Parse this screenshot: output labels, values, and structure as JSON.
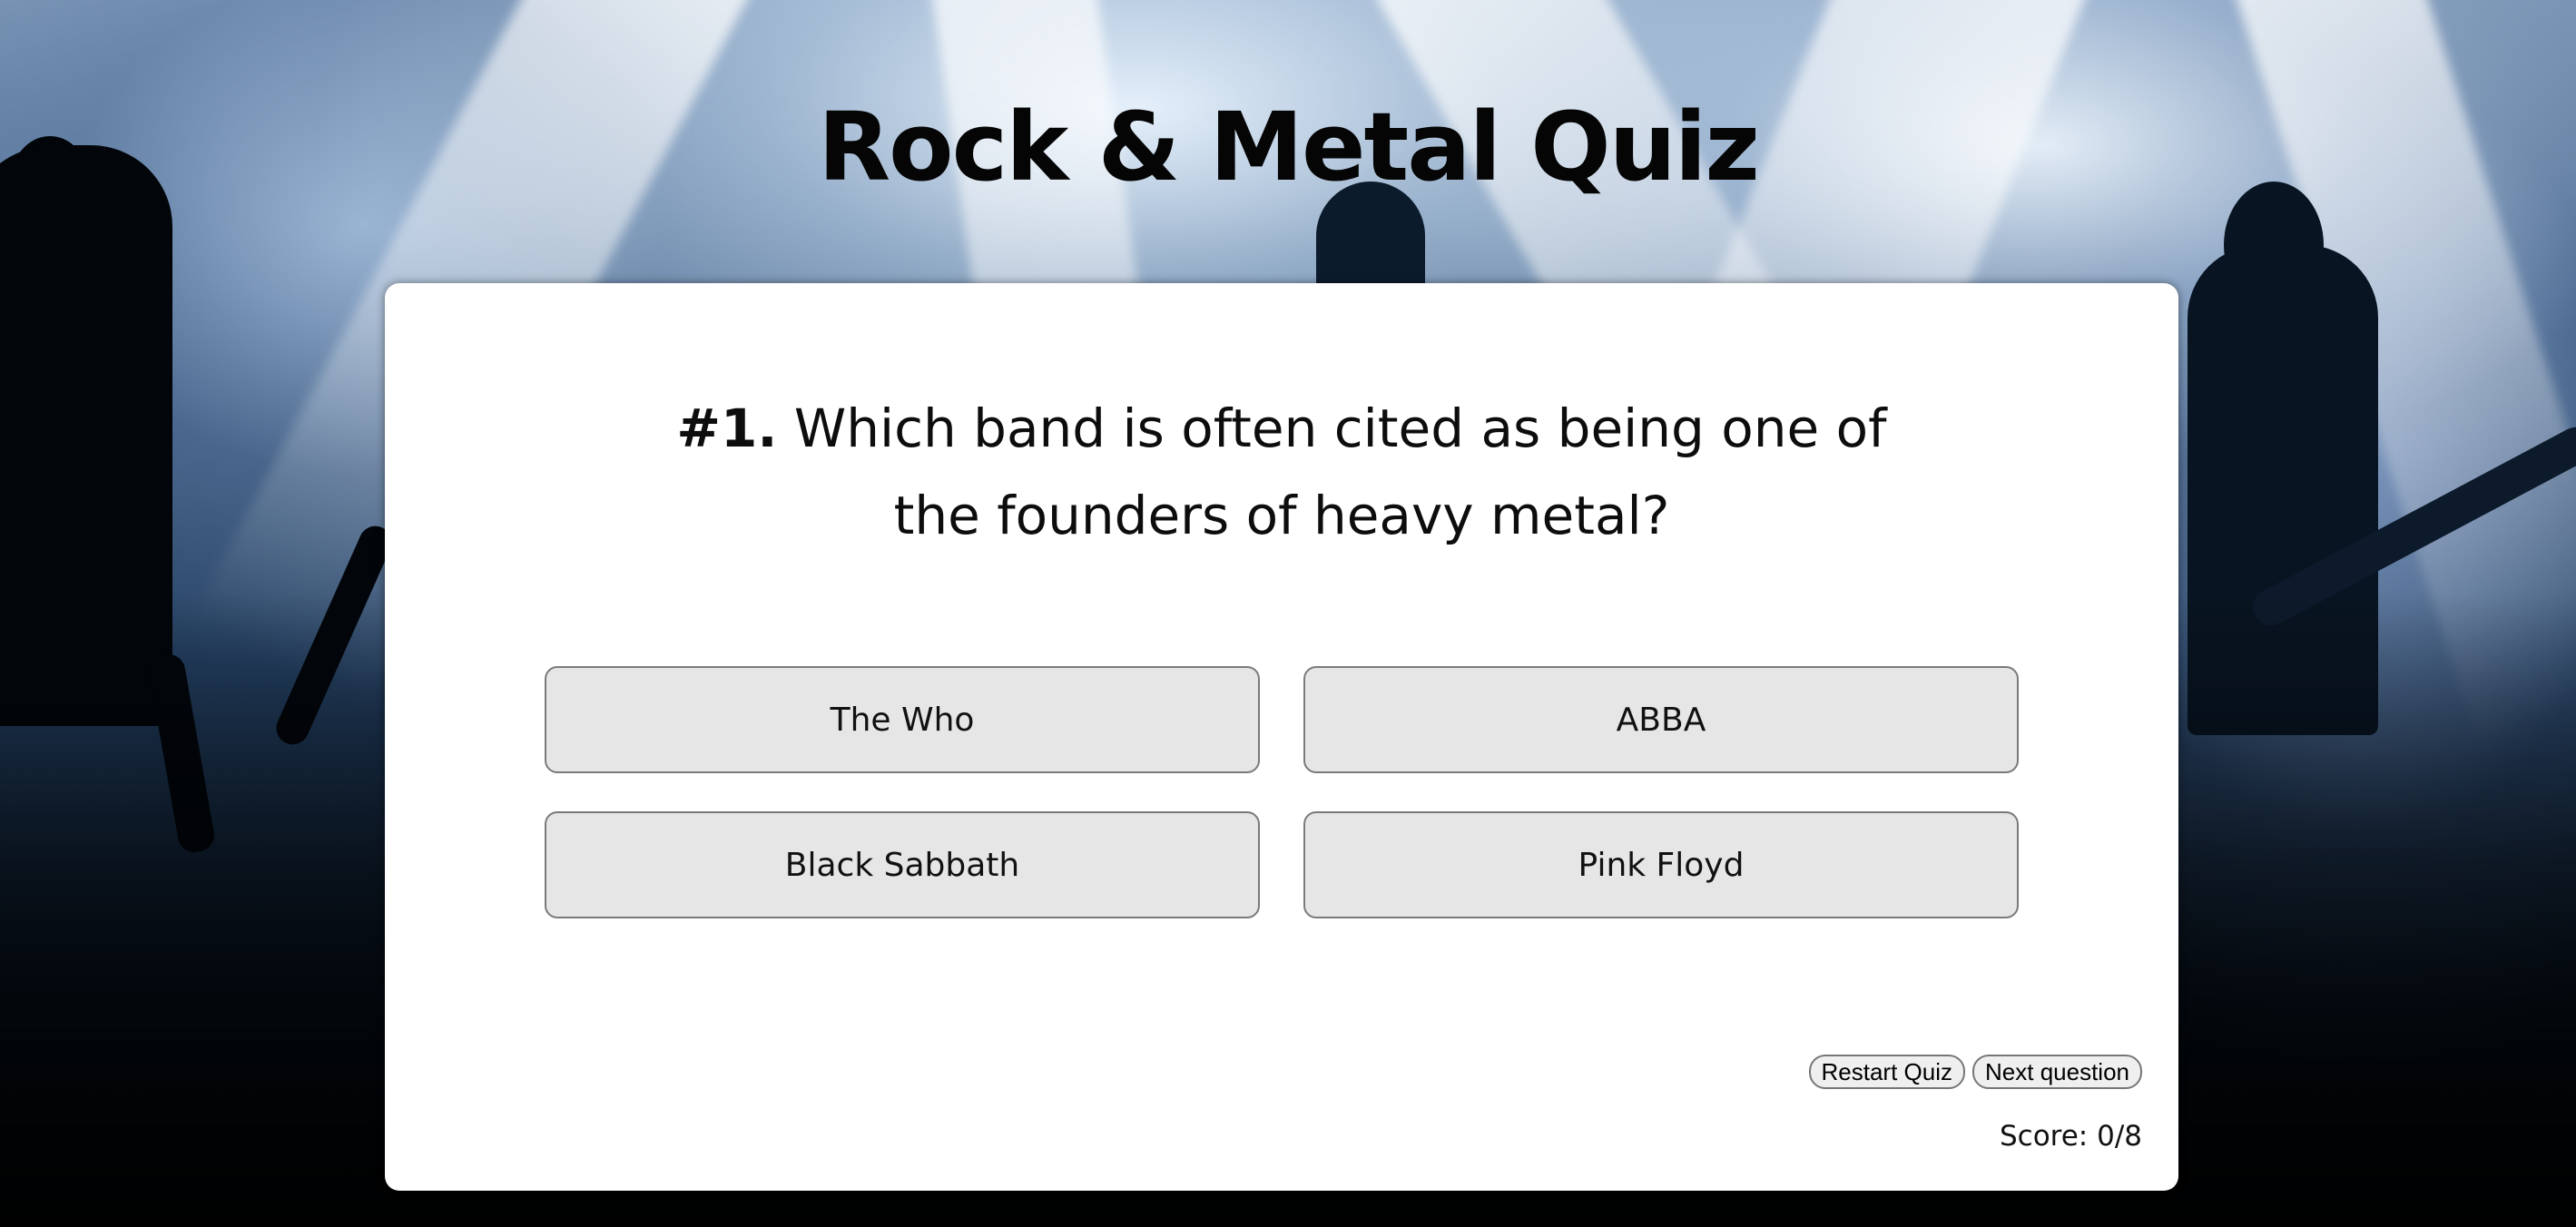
{
  "app": {
    "title": "Rock & Metal Quiz"
  },
  "quiz": {
    "question_number": "#1.",
    "question_text": "Which band is often cited as being one of the founders of heavy metal?",
    "answers": [
      {
        "label": "The Who"
      },
      {
        "label": "ABBA"
      },
      {
        "label": "Black Sabbath"
      },
      {
        "label": "Pink Floyd"
      }
    ]
  },
  "controls": {
    "restart_label": "Restart Quiz",
    "next_label": "Next question"
  },
  "score": {
    "text": "Score: 0/8"
  },
  "colors": {
    "card_background": "#ffffff",
    "answer_background": "#e6e6e6",
    "answer_border": "#7a7a7a",
    "title_color": "#050505"
  },
  "background": {
    "icon": "concert-crowd-stage-lights"
  }
}
